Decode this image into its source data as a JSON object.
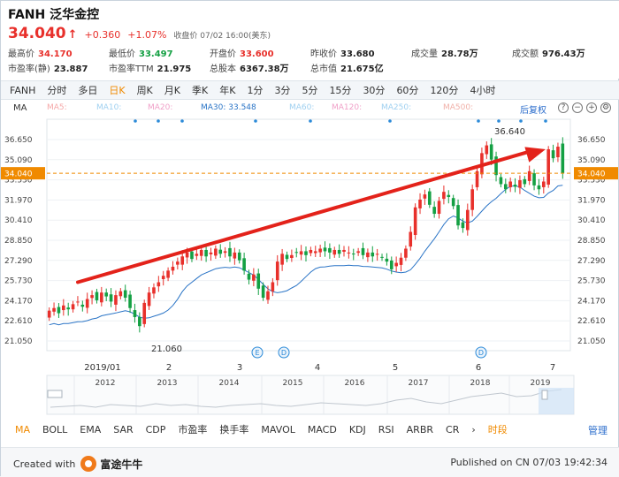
{
  "header": {
    "symbol": "FANH",
    "name": "泛华金控",
    "price": "34.040",
    "price_arrow": "↑",
    "change": "+0.360",
    "change_pct": "+1.07%",
    "close_note": "收盘价 07/02 16:00(美东)"
  },
  "stats": [
    {
      "label": "最高价",
      "value": "34.170",
      "tone": "red"
    },
    {
      "label": "最低价",
      "value": "33.497",
      "tone": "green"
    },
    {
      "label": "开盘价",
      "value": "33.600",
      "tone": "red"
    },
    {
      "label": "昨收价",
      "value": "33.680",
      "tone": ""
    },
    {
      "label": "成交量",
      "value": "28.78万",
      "tone": ""
    },
    {
      "label": "成交额",
      "value": "976.43万",
      "tone": ""
    },
    {
      "label": "市盈率(静)",
      "value": "23.887",
      "tone": ""
    },
    {
      "label": "市盈率TTM",
      "value": "21.975",
      "tone": ""
    },
    {
      "label": "总股本",
      "value": "6367.38万",
      "tone": ""
    },
    {
      "label": "总市值",
      "value": "21.675亿",
      "tone": ""
    }
  ],
  "period_tabs": [
    "FANH",
    "分时",
    "多日",
    "日K",
    "周K",
    "月K",
    "季K",
    "年K",
    "1分",
    "3分",
    "5分",
    "15分",
    "30分",
    "60分",
    "120分",
    "4小时"
  ],
  "active_period": "日K",
  "ma_bar": {
    "label": "MA",
    "items": [
      {
        "text": "MA5:",
        "color": "#f5a8a8"
      },
      {
        "text": "MA10:",
        "color": "#9fd0f0"
      },
      {
        "text": "MA20:",
        "color": "#f0a0c8"
      },
      {
        "text": "MA30: 33.548",
        "color": "#2a74c6"
      },
      {
        "text": "MA60:",
        "color": "#9fd0f0"
      },
      {
        "text": "MA120:",
        "color": "#f0a0c8"
      },
      {
        "text": "MA250:",
        "color": "#9fd0f0"
      },
      {
        "text": "MA500:",
        "color": "#f0b0a8"
      }
    ],
    "adjust": "后复权"
  },
  "chart_data": {
    "type": "candlestick",
    "yticks": [
      36.65,
      35.09,
      33.53,
      31.97,
      30.41,
      28.85,
      27.29,
      25.73,
      24.17,
      22.61,
      21.05
    ],
    "ytick_labels": [
      "36.650",
      "35.090",
      "33.530",
      "31.970",
      "30.410",
      "28.850",
      "27.290",
      "25.730",
      "24.170",
      "22.610",
      "21.050"
    ],
    "ylim": [
      21.05,
      36.65
    ],
    "current_price": "34.040",
    "x_month_labels": [
      "2019/01",
      "2",
      "3",
      "4",
      "5",
      "6",
      "7"
    ],
    "high_annotation": "36.640",
    "low_annotation": "21.060",
    "close_series": [
      23.4,
      23.6,
      23.2,
      23.8,
      23.5,
      23.9,
      24.1,
      23.7,
      24.3,
      24.6,
      24.2,
      24.8,
      24.5,
      24.1,
      24.6,
      24.9,
      24.4,
      23.6,
      22.9,
      22.2,
      24.0,
      24.8,
      25.2,
      25.6,
      26.1,
      26.5,
      26.8,
      27.2,
      27.6,
      27.9,
      27.4,
      27.8,
      28.1,
      27.6,
      27.9,
      28.2,
      27.8,
      28.0,
      27.6,
      27.9,
      27.3,
      26.5,
      25.8,
      26.2,
      25.1,
      24.4,
      24.9,
      25.6,
      27.2,
      27.8,
      27.4,
      27.7,
      27.9,
      28.0,
      27.7,
      28.1,
      28.0,
      28.2,
      28.0,
      27.9,
      28.1,
      27.8,
      28.1,
      27.9,
      27.8,
      28.0,
      27.7,
      27.9,
      27.6,
      27.8,
      27.5,
      27.2,
      26.6,
      27.1,
      27.5,
      28.2,
      29.5,
      31.4,
      32.0,
      32.4,
      31.6,
      30.9,
      31.9,
      32.6,
      32.2,
      31.5,
      30.0,
      29.8,
      31.2,
      32.8,
      34.2,
      35.6,
      36.2,
      35.1,
      33.9,
      33.2,
      32.8,
      33.4,
      33.0,
      33.5,
      33.2,
      34.2,
      33.1,
      32.8,
      33.4,
      35.9,
      35.2,
      36.1,
      34.04
    ],
    "annotation_markers": [
      "E",
      "D",
      "D"
    ]
  },
  "range_years": [
    "2012",
    "2013",
    "2014",
    "2015",
    "2016",
    "2017",
    "2018",
    "2019"
  ],
  "indicator_tabs": [
    "MA",
    "BOLL",
    "EMA",
    "SAR",
    "CDP",
    "市盈率",
    "换手率",
    "MAVOL",
    "MACD",
    "KDJ",
    "RSI",
    "ARBR",
    "CR"
  ],
  "indicator_more": "›",
  "indicator_extra": "时段",
  "indicator_manage": "管理",
  "footer": {
    "created": "Created with",
    "brand": "富途牛牛",
    "published": "Published on CN 07/03 19:42:34"
  },
  "colors": {
    "up": "#e8302b",
    "down": "#14a043",
    "ma30": "#2a74c6",
    "accent": "#f08a00"
  }
}
